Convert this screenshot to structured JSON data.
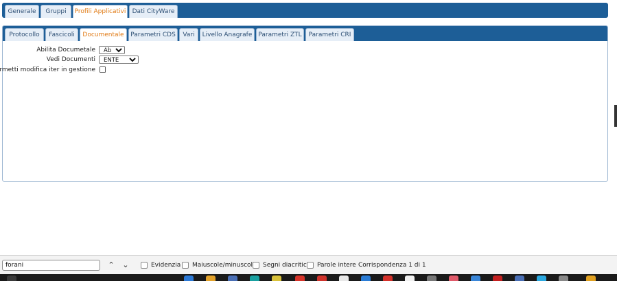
{
  "top_tabs": [
    {
      "label": "Generale",
      "active": false
    },
    {
      "label": "Gruppi",
      "active": false
    },
    {
      "label": "Profili Applicativi",
      "active": true
    },
    {
      "label": "Dati CityWare",
      "active": false
    }
  ],
  "sub_tabs": [
    {
      "label": "Protocollo",
      "active": false
    },
    {
      "label": "Fascicoli",
      "active": false
    },
    {
      "label": "Documentale",
      "active": true
    },
    {
      "label": "Parametri CDS",
      "active": false
    },
    {
      "label": "Vari",
      "active": false
    },
    {
      "label": "Livello Anagrafe",
      "active": false
    },
    {
      "label": "Parametri ZTL",
      "active": false
    },
    {
      "label": "Parametri CRI",
      "active": false
    }
  ],
  "form": {
    "abilita_label": "Abilita Documetale",
    "abilita_value": "Abilita",
    "vedi_label": "Vedi Documenti",
    "vedi_value": "ENTE",
    "permetti_label": "Permetti modifica iter in gestione",
    "permetti_checked": false
  },
  "findbar": {
    "query": "forani",
    "prev_icon": "chevron-up-icon",
    "next_icon": "chevron-down-icon",
    "options": [
      "Evidenzia",
      "Maiuscole/minuscole",
      "Segni diacritici",
      "Parole intere"
    ],
    "match_text": "Corrispondenza 1 di 1"
  },
  "colors": {
    "tabbar": "#1d5e97",
    "active_tab_text": "#e07a14",
    "tab_text": "#2d4f74"
  }
}
